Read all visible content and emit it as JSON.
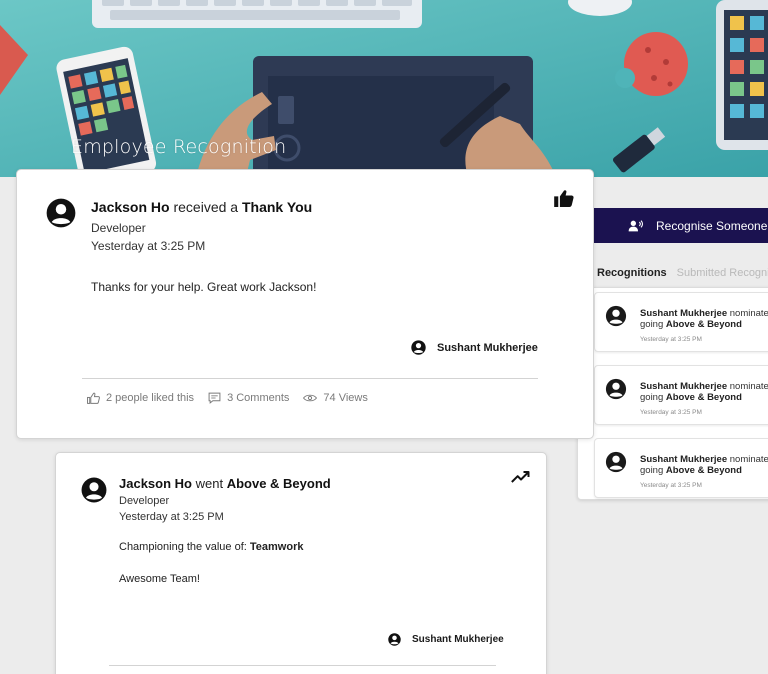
{
  "banner": {
    "title": "Employee Recognition"
  },
  "sidebar": {
    "recognise_button": "Recognise Someone",
    "tabs": [
      {
        "label": "Recognitions",
        "active": true
      },
      {
        "label": "Submitted Recognitions",
        "active": false
      }
    ],
    "items": [
      {
        "name": "Sushant Mukherjee",
        "action": "nominated you for",
        "line2_prefix": "going",
        "award": "Above & Beyond",
        "time": "Yesterday at 3:25 PM"
      },
      {
        "name": "Sushant Mukherjee",
        "action": "nominated you for",
        "line2_prefix": "going",
        "award": "Above & Beyond",
        "time": "Yesterday at 3:25 PM"
      },
      {
        "name": "Sushant Mukherjee",
        "action": "nominated you for",
        "line2_prefix": "going",
        "award": "Above & Beyond",
        "time": "Yesterday at 3:25 PM"
      }
    ]
  },
  "feed": [
    {
      "recipient": "Jackson Ho",
      "verb": "received a",
      "award": "Thank You",
      "role": "Developer",
      "time": "Yesterday at 3:25 PM",
      "message": "Thanks for your help. Great work Jackson!",
      "sender": "Sushant Mukherjee",
      "likes": "2 people liked this",
      "comments": "3 Comments",
      "views": "74 Views",
      "icon": "thumbs-up-icon"
    },
    {
      "recipient": "Jackson Ho",
      "verb": "went",
      "award": "Above & Beyond",
      "role": "Developer",
      "time": "Yesterday at 3:25 PM",
      "value_prefix": "Championing the value of:",
      "value": "Teamwork",
      "message": "Awesome Team!",
      "sender": "Sushant Mukherjee",
      "icon": "trending-up-icon"
    }
  ],
  "colors": {
    "accent": "#1b1250",
    "banner": "#4fb4b8"
  }
}
